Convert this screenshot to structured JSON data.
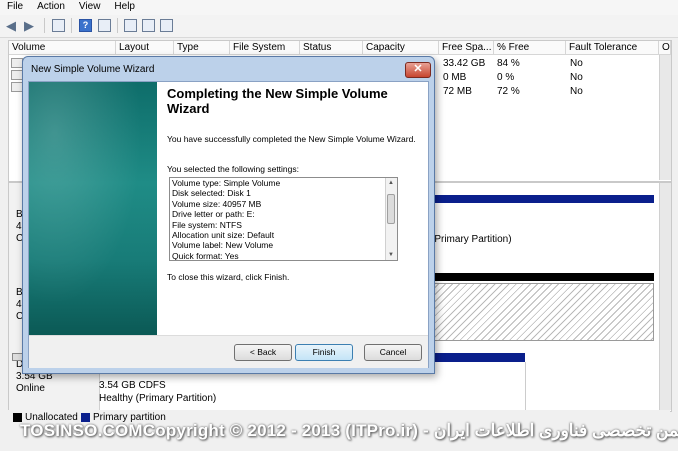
{
  "menu": [
    "File",
    "Action",
    "View",
    "Help"
  ],
  "volume_list": {
    "columns": [
      "Volume",
      "Layout",
      "Type",
      "File System",
      "Status",
      "Capacity",
      "Free Spa...",
      "% Free",
      "Fault Tolerance",
      "O"
    ],
    "rows": [
      {
        "free": "33.42 GB",
        "pct": "84 %",
        "fault": "No"
      },
      {
        "free": "0 MB",
        "pct": "0 %",
        "fault": "No"
      },
      {
        "free": "72 MB",
        "pct": "72 %",
        "fault": "No"
      }
    ]
  },
  "disk_map": {
    "left_fragments": [
      "B",
      "4",
      "C",
      "B",
      "4",
      "C",
      "D"
    ],
    "partition_text": "(Primary Partition)",
    "cd": {
      "size": "3.54 GB",
      "status": "Online",
      "fs": "3.54 GB CDFS",
      "health": "Healthy (Primary Partition)"
    }
  },
  "legend": {
    "unallocated": "Unallocated",
    "primary": "Primary partition"
  },
  "watermark": "TOSINSO.COMCopyright © 2012 - 2013 (ITPro.ir) - انجمن تخصصی فناوری اطلاعات ایران",
  "wizard": {
    "title": "New Simple Volume Wizard",
    "heading": "Completing the New Simple Volume Wizard",
    "intro": "You have successfully completed the New Simple Volume Wizard.",
    "settings_label": "You selected the following settings:",
    "settings": [
      "Volume type: Simple Volume",
      "Disk selected: Disk 1",
      "Volume size: 40957 MB",
      "Drive letter or path: E:",
      "File system: NTFS",
      "Allocation unit size: Default",
      "Volume label: New Volume",
      "Quick format: Yes"
    ],
    "close_text": "To close this wizard, click Finish.",
    "buttons": {
      "back": "< Back",
      "finish": "Finish",
      "cancel": "Cancel"
    }
  },
  "colors": {
    "primary_partition": "#0a1f8c",
    "unallocated": "#000000",
    "wizard_side": "#1f8c86"
  }
}
